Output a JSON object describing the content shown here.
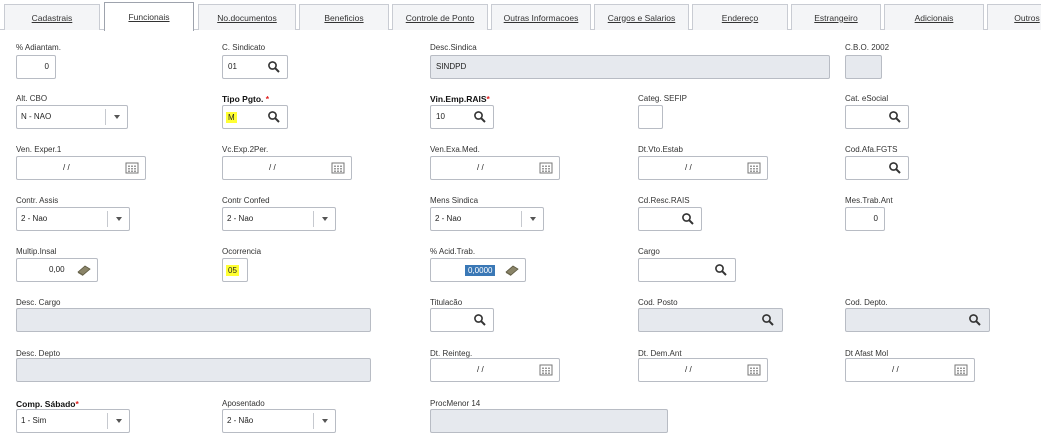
{
  "tabs": [
    "Cadastrais",
    "Funcionais",
    "No.documentos",
    "Beneficios",
    "Controle de Ponto",
    "Outras Informacoes",
    "Cargos e Salarios",
    "Endereço",
    "Estrangeiro",
    "Adicionais",
    "Outros"
  ],
  "active_tab": "Funcionais",
  "fields": {
    "adiantam": {
      "label": "% Adiantam.",
      "value": "0"
    },
    "c_sindicato": {
      "label": "C. Sindicato",
      "value": "01"
    },
    "desc_sindica": {
      "label": "Desc.Sindica",
      "value": "SINDPD"
    },
    "cbo_2002": {
      "label": "C.B.O. 2002",
      "value": ""
    },
    "alt_cbo": {
      "label": "Alt. CBO",
      "value": "N - NAO"
    },
    "tipo_pgto": {
      "label": "Tipo Pgto.",
      "required": "*",
      "value": "M"
    },
    "vin_emp_rais": {
      "label": "Vin.Emp.RAIS",
      "required": "*",
      "value": "10"
    },
    "categ_sefip": {
      "label": "Categ. SEFIP",
      "value": ""
    },
    "cat_esocial": {
      "label": "Cat. eSocial",
      "value": ""
    },
    "ven_exper_1": {
      "label": "Ven. Exper.1",
      "value": "/ /"
    },
    "vc_exp_2per": {
      "label": "Vc.Exp.2Per.",
      "value": "/ /"
    },
    "ven_exa_med": {
      "label": "Ven.Exa.Med.",
      "value": "/ /"
    },
    "dt_vto_estab": {
      "label": "Dt.Vto.Estab",
      "value": "/ /"
    },
    "cod_afa_fgts": {
      "label": "Cod.Afa.FGTS",
      "value": ""
    },
    "contr_assis": {
      "label": "Contr. Assis",
      "value": "2 - Nao"
    },
    "contr_confed": {
      "label": "Contr Confed",
      "value": "2 - Nao"
    },
    "mens_sindica": {
      "label": "Mens Sindica",
      "value": "2 - Nao"
    },
    "cd_resc_rais": {
      "label": "Cd.Resc.RAIS",
      "value": ""
    },
    "mes_trab_ant": {
      "label": "Mes.Trab.Ant",
      "value": "0"
    },
    "multip_insal": {
      "label": "Multip.Insal",
      "value": "0,00"
    },
    "ocorrencia": {
      "label": "Ocorrencia",
      "value": "05"
    },
    "acid_trab": {
      "label": "% Acid.Trab.",
      "value": "0,0000"
    },
    "cargo": {
      "label": "Cargo",
      "value": ""
    },
    "desc_cargo": {
      "label": "Desc. Cargo",
      "value": ""
    },
    "titulacao": {
      "label": "Titulacão",
      "value": ""
    },
    "cod_posto": {
      "label": "Cod. Posto",
      "value": ""
    },
    "cod_depto": {
      "label": "Cod. Depto.",
      "value": ""
    },
    "desc_depto": {
      "label": "Desc. Depto",
      "value": ""
    },
    "dt_reinteg": {
      "label": "Dt. Reinteg.",
      "value": "/ /"
    },
    "dt_dem_ant": {
      "label": "Dt. Dem.Ant",
      "value": "/ /"
    },
    "dt_afast_mol": {
      "label": "Dt Afast Mol",
      "value": "/ /"
    },
    "comp_sabado": {
      "label": "Comp. Sábado",
      "required": "*",
      "value": "1 - Sim"
    },
    "aposentado": {
      "label": "Aposentado",
      "value": "2 - Não"
    },
    "procmenor_14": {
      "label": "ProcMenor 14",
      "value": ""
    }
  },
  "colors": {
    "highlight": "#ffff33",
    "selection": "#3a78b6",
    "readonly_bg": "#e6e9ee",
    "required": "#e02020"
  }
}
